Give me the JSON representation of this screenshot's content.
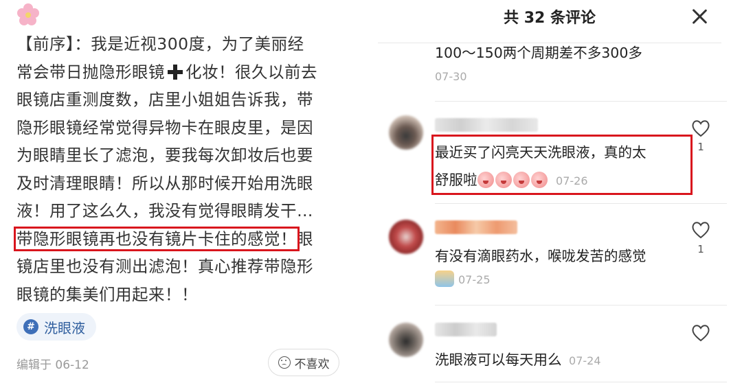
{
  "post": {
    "lines": [
      "【前序】：我是近视300度，为了美丽经",
      "常会带日抛隐形眼镜",
      "化妆！很久以前去",
      "眼镜店重测度数，店里小姐姐告诉我，带",
      "隐形眼镜经常觉得异物卡在眼皮里，是因",
      "为眼睛里长了滤泡，要我每次卸妆后也要",
      "及时清理眼睛！所以从那时候开始用洗眼",
      "液！用了这么久，我没有觉得眼睛发干…",
      "带隐形眼镜再也没有镜片卡住的感觉！",
      "眼",
      "镜店里也没有测出滤泡！真心推荐带隐形",
      "眼镜的集美们用起来！！"
    ],
    "tag_label": "洗眼液",
    "edit_time": "编辑于 06-12",
    "dislike_label": "不喜欢"
  },
  "comments_sheet": {
    "title": "共 32 条评论",
    "comments": [
      {
        "text": "100～150两个周期差不多300多",
        "date": "07-30"
      },
      {
        "text_line1": "最近买了闪亮天天洗眼液，真的太",
        "text_line2": "舒服啦",
        "date": "07-26",
        "likes": "1"
      },
      {
        "text": "有没有滴眼药水，喉咙发苦的感觉",
        "date": "07-25",
        "likes": "1"
      },
      {
        "text": "洗眼液可以每天用么",
        "date": "07-24"
      }
    ]
  },
  "colors": {
    "highlight": "#d9151d",
    "tag_bg": "#eef3fa",
    "tag_text": "#2f5e9e"
  },
  "icons": {
    "post_decoration": "flower-icon",
    "tag": "hashtag-icon",
    "close": "close-icon",
    "like": "heart-icon",
    "dislike": "sad-face-icon"
  }
}
